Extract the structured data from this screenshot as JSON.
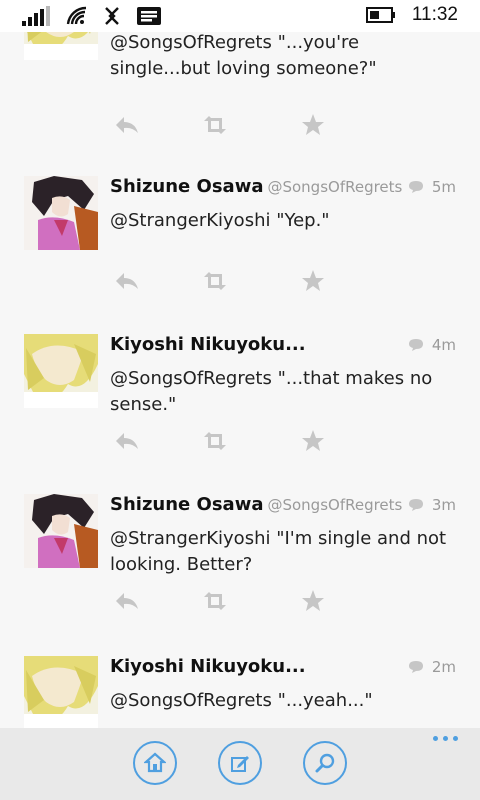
{
  "status_bar": {
    "time": "11:32",
    "icons": [
      "signal-icon",
      "wifi-icon",
      "data-icon",
      "message-icon",
      "battery-icon"
    ]
  },
  "tweets": [
    {
      "name": "",
      "handle": "",
      "time": "",
      "text": "@SongsOfRegrets \"...you're single...but loving someone?\"",
      "avatar": "blonde-avatar"
    },
    {
      "name": "Shizune Osawa",
      "handle": "@SongsOfRegrets",
      "time": "5m",
      "text": "@StrangerKiyoshi \"Yep.\"",
      "avatar": "darkhair-avatar"
    },
    {
      "name": "Kiyoshi Nikuyoku...",
      "handle": "",
      "time": "4m",
      "text": "@SongsOfRegrets \"...that makes no sense.\"",
      "avatar": "blonde-avatar"
    },
    {
      "name": "Shizune Osawa",
      "handle": "@SongsOfRegrets",
      "time": "3m",
      "text": "@StrangerKiyoshi \"I'm single and not looking. Better?",
      "avatar": "darkhair-avatar"
    },
    {
      "name": "Kiyoshi Nikuyoku...",
      "handle": "",
      "time": "2m",
      "text": "@SongsOfRegrets \"...yeah...\"",
      "avatar": "blonde-avatar"
    }
  ],
  "tweet_actions": [
    "reply-icon",
    "retweet-icon",
    "favorite-icon"
  ],
  "app_bar": {
    "buttons": [
      "home-icon",
      "compose-icon",
      "search-icon"
    ],
    "more": "more-icon"
  },
  "colors": {
    "accent": "#4f9fe0",
    "icon_gray": "#c6c6c6",
    "meta_gray": "#9a9a9a",
    "appbar_bg": "#e9e9e9"
  }
}
